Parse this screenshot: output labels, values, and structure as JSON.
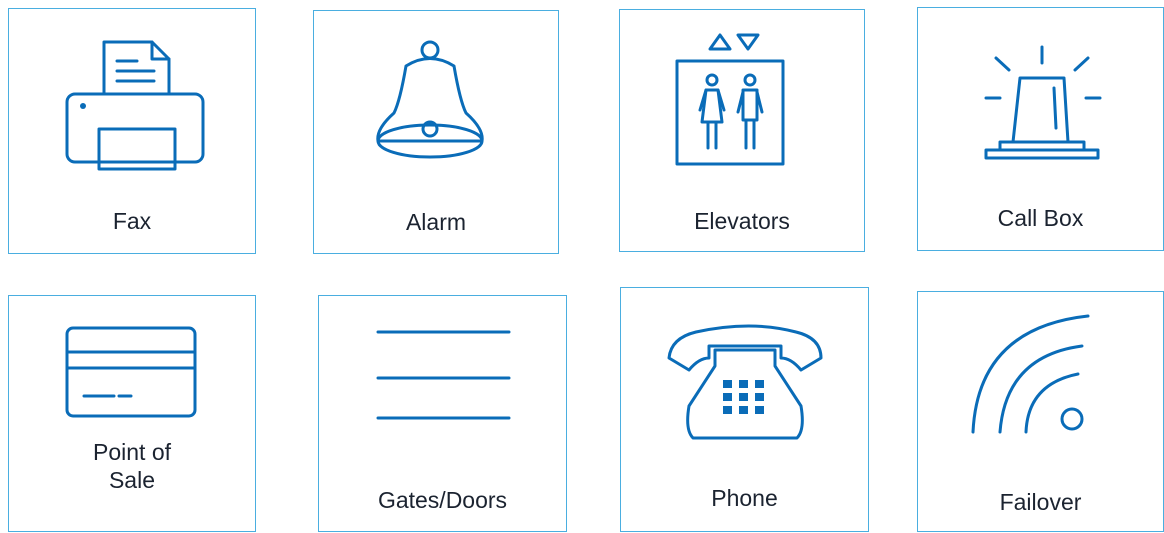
{
  "tiles": [
    {
      "label": "Fax",
      "icon": "fax-icon"
    },
    {
      "label": "Alarm",
      "icon": "bell-icon"
    },
    {
      "label": "Elevators",
      "icon": "elevator-icon"
    },
    {
      "label": "Call Box",
      "icon": "siren-icon"
    },
    {
      "label": "Point of\nSale",
      "icon": "credit-card-icon"
    },
    {
      "label": "Gates/Doors",
      "icon": "gate-lines-icon"
    },
    {
      "label": "Phone",
      "icon": "telephone-icon"
    },
    {
      "label": "Failover",
      "icon": "signal-waves-icon"
    }
  ],
  "colors": {
    "border": "#4aaee0",
    "icon": "#0a6cb8",
    "text": "#1b2330"
  }
}
